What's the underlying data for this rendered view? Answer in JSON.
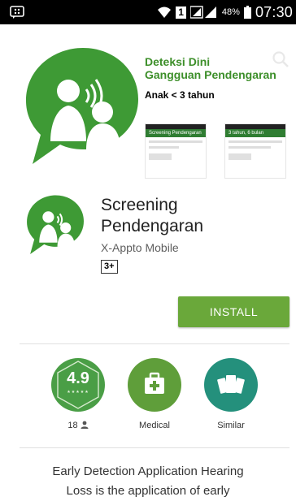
{
  "status_bar": {
    "sim_badge": "1",
    "battery_percent": "48%",
    "time": "07:30"
  },
  "banner": {
    "title_line1": "Deteksi Dini",
    "title_line2": "Gangguan Pendengaran",
    "subtitle": "Anak < 3 tahun",
    "screenshot1_title": "Screening Pendengaran",
    "screenshot2_title": "3 tahun, 6 bulan"
  },
  "app": {
    "name_line1": "Screening",
    "name_line2": "Pendengaran",
    "developer": "X-Appto Mobile",
    "content_rating": "3+",
    "install_label": "INSTALL"
  },
  "stats": {
    "rating": "4.9",
    "rating_count": "18",
    "category": "Medical",
    "similar": "Similar"
  },
  "description": {
    "line1": "Early Detection Application Hearing",
    "line2": "Loss is the application of early"
  },
  "colors": {
    "brand_green": "#3d8f2a",
    "install_green": "#6aa83a",
    "stat_green": "#4a9e46",
    "similar_teal": "#24907c"
  },
  "icons": [
    "bbm-icon",
    "wifi-icon",
    "signal-icon",
    "battery-icon",
    "back-arrow-icon",
    "search-icon",
    "user-icon",
    "medical-kit-icon",
    "similar-cards-icon"
  ]
}
